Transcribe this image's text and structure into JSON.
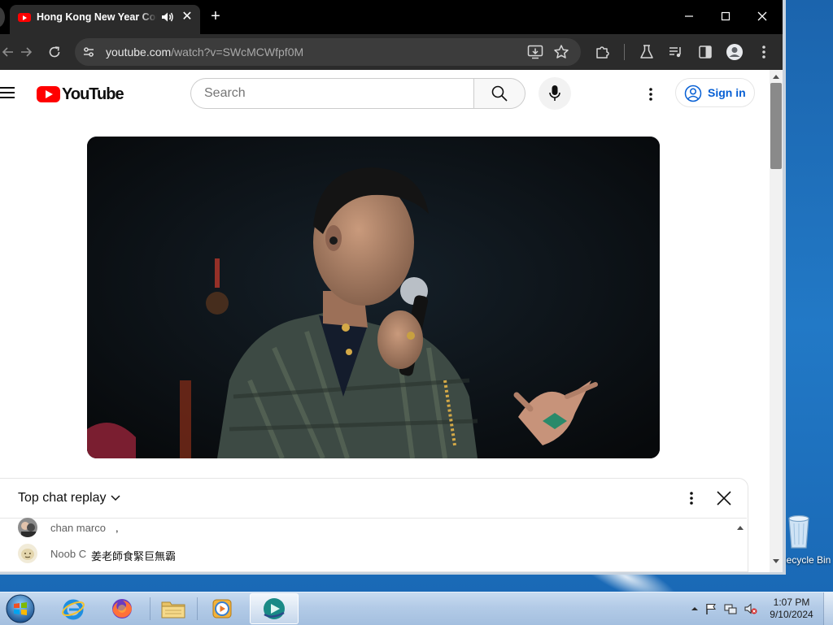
{
  "browser": {
    "tab": {
      "title": "Hong Kong New Year Countdown",
      "favicon": "youtube-favicon-icon"
    },
    "new_tab_label": "+",
    "address": {
      "host": "youtube.com",
      "path": "/watch?v=SWcMCWfpf0M"
    }
  },
  "youtube": {
    "logo_text": "YouTube",
    "search_placeholder": "Search",
    "sign_in_label": "Sign in",
    "accent": "#ff0000",
    "link_color": "#065fd4"
  },
  "chat": {
    "title": "Top chat replay",
    "messages": [
      {
        "author": "chan marco",
        "text": ","
      },
      {
        "author": "Noob C",
        "text": "姜老師食緊巨無霸"
      }
    ]
  },
  "desktop": {
    "recycle_bin_label": "Recycle Bin"
  },
  "taskbar": {
    "apps": [
      "start-orb",
      "internet-explorer",
      "firefox",
      "windows-explorer",
      "media-player",
      "active-app"
    ],
    "clock": {
      "time": "1:07 PM",
      "date": "9/10/2024"
    }
  }
}
